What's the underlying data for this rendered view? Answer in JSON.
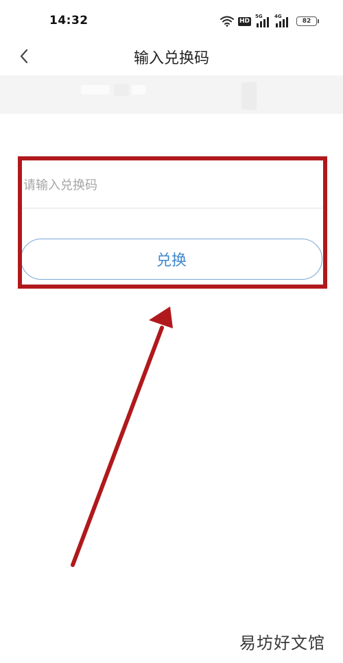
{
  "status_bar": {
    "time": "14:32",
    "hd_label": "HD",
    "network_5g": "5G",
    "network_4g": "4G",
    "battery": "82"
  },
  "nav": {
    "back_icon": "chevron-left-icon",
    "title": "输入兑换码"
  },
  "redeem": {
    "input_value": "",
    "input_placeholder": "请输入兑换码",
    "button_label": "兑换"
  },
  "annotation": {
    "box_color": "#b0191c",
    "arrow_color": "#b0191c"
  },
  "watermark": {
    "text": "易坊好文馆"
  },
  "colors": {
    "accent": "#3e87cf",
    "button_border": "#7aa8d6",
    "placeholder": "#a6a6a6"
  }
}
